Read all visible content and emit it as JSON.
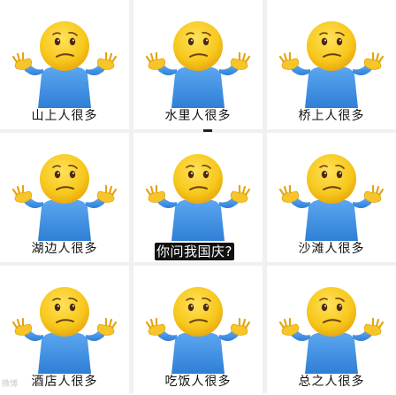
{
  "tiles": [
    {
      "caption": "山上人很多"
    },
    {
      "caption": "水里人很多"
    },
    {
      "caption": "桥上人很多"
    },
    {
      "caption": "湖边人很多"
    },
    {
      "caption": ""
    },
    {
      "caption": "沙滩人很多"
    },
    {
      "caption": "酒店人很多"
    },
    {
      "caption": "吃饭人很多"
    },
    {
      "caption": "总之人很多"
    }
  ],
  "center_caption": "你问我国庆?",
  "watermark": "微博",
  "emoji_icon": "shrug-emoji-icon",
  "colors": {
    "face": "#f7c81c",
    "face_shade": "#e9a90f",
    "shirt": "#3b8fe0",
    "hand": "#f6c52a",
    "divider": "#f0f0f0"
  }
}
